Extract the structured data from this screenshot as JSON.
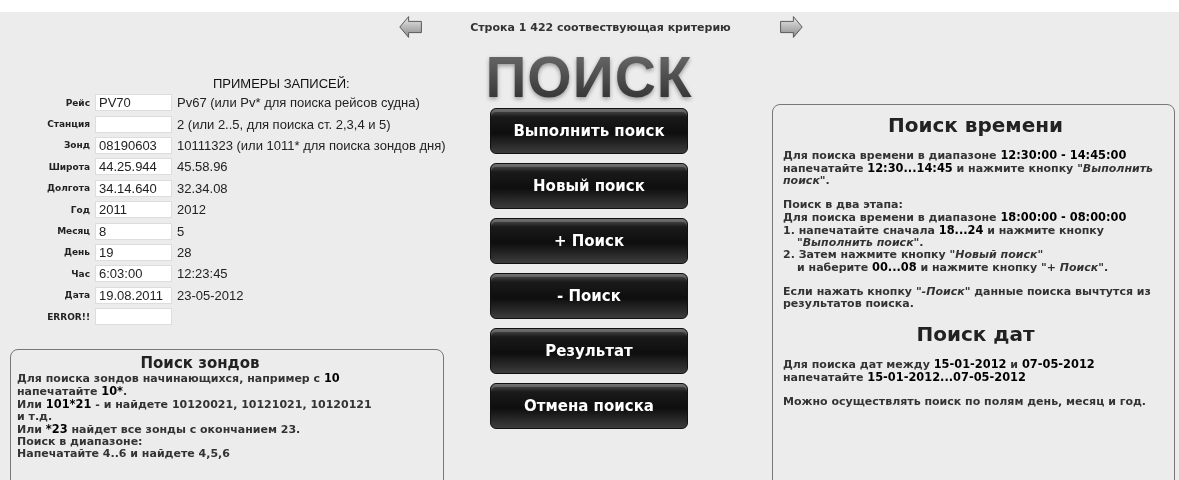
{
  "navigator": {
    "status": "Строка 1  422 соотвествующая критерию"
  },
  "examples": {
    "heading": "ПРИМЕРЫ ЗАПИСЕЙ:",
    "fields": [
      {
        "label": "Рейс",
        "value": "PV70",
        "example": "Pv67 (или Pv* для поиска рейсов судна)"
      },
      {
        "label": "Станция",
        "example": "2 (или 2..5, для поиска ст. 2,3,4 и 5)"
      },
      {
        "label": "Зонд",
        "value": "08190603",
        "example": "10111323 (или 1011* для поиска зондов дня)"
      },
      {
        "label": "Широта",
        "value": "44.25.944",
        "example": "45.58.96"
      },
      {
        "label": "Долгота",
        "value": "34.14.640",
        "example": "32.34.08"
      },
      {
        "label": "Год",
        "value": "2011",
        "example": "2012"
      },
      {
        "label": "Месяц",
        "value": "8",
        "example": "5"
      },
      {
        "label": "День",
        "value": "19",
        "example": "28"
      },
      {
        "label": "Час",
        "value": "6:03:00",
        "example": "12:23:45"
      },
      {
        "label": "Дата",
        "value": "19.08.2011",
        "example": "23-05-2012"
      },
      {
        "label": "ERROR!!"
      }
    ]
  },
  "title": "ПОИСК",
  "buttons": [
    "Выполнить поиск",
    "Новый поиск",
    "+ Поиск",
    "- Поиск",
    "Результат",
    "Отмена поиска"
  ],
  "probe_help": {
    "title": "Поиск зондов",
    "lines": [
      {
        "indented": false,
        "parts": [
          {
            "kind": "plain",
            "text": "Для поиска зондов начинающихся, например с "
          },
          {
            "kind": "strong",
            "text": "10"
          },
          {
            "kind": "plain",
            "text": " напечатайте "
          },
          {
            "kind": "strong",
            "text": "10*"
          },
          {
            "kind": "plain",
            "text": "."
          }
        ]
      },
      {
        "indented": false,
        "parts": [
          {
            "kind": "plain",
            "text": "Или  "
          },
          {
            "kind": "strong",
            "text": "101*21"
          },
          {
            "kind": "plain",
            "text": " - и найдете  10120021, 10121021, 10120121 и т.д."
          }
        ]
      },
      {
        "indented": false,
        "parts": [
          {
            "kind": "plain",
            "text": "Или  "
          },
          {
            "kind": "strong",
            "text": "*23"
          },
          {
            "kind": "plain",
            "text": " найдет все зонды с окончанием  23."
          }
        ]
      },
      {
        "indented": false,
        "parts": [
          {
            "kind": "plain",
            "text": "Поиск в диапазоне:"
          }
        ]
      },
      {
        "indented": false,
        "parts": [
          {
            "kind": "plain",
            "text": "Напечатайте 4..6 и найдете 4,5,6"
          }
        ]
      }
    ]
  },
  "time_help": {
    "blocks": [
      {
        "kind": "heading",
        "text": "Поиск времени"
      },
      {
        "kind": "paragraph",
        "lines": [
          {
            "indented": false,
            "parts": [
              {
                "kind": "plain",
                "text": "Для поиска времени в диапазоне "
              },
              {
                "kind": "strong",
                "text": "12:30:00 - 14:45:00"
              },
              {
                "kind": "plain",
                "text": " напечатайте "
              },
              {
                "kind": "strong",
                "text": "12:30...14:45"
              },
              {
                "kind": "plain",
                "text": " и нажмите кнопку "
              },
              {
                "kind": "em",
                "text": "\"Выполнить поиск\""
              },
              {
                "kind": "plain",
                "text": "."
              }
            ]
          }
        ]
      },
      {
        "kind": "paragraph",
        "lines": [
          {
            "indented": false,
            "parts": [
              {
                "kind": "plain",
                "text": "Поиск в два этапа:"
              }
            ]
          },
          {
            "indented": false,
            "parts": [
              {
                "kind": "plain",
                "text": "Для поиска времени в диапазоне "
              },
              {
                "kind": "strong",
                "text": "18:00:00 - 08:00:00"
              }
            ]
          },
          {
            "indented": false,
            "parts": [
              {
                "kind": "plain",
                "text": "1. напечатайте  сначала "
              },
              {
                "kind": "strong",
                "text": "18...24"
              },
              {
                "kind": "plain",
                "text": " и нажмите кнопку"
              }
            ]
          },
          {
            "indented": true,
            "parts": [
              {
                "kind": "em",
                "text": "\"Выполнить поиск\""
              },
              {
                "kind": "plain",
                "text": "."
              }
            ]
          },
          {
            "indented": false,
            "parts": [
              {
                "kind": "plain",
                "text": "2. Затем нажмите кнопку "
              },
              {
                "kind": "em",
                "text": "\"Новый поиск\""
              }
            ]
          },
          {
            "indented": true,
            "parts": [
              {
                "kind": "plain",
                "text": "и наберите "
              },
              {
                "kind": "strong",
                "text": "00...08"
              },
              {
                "kind": "plain",
                "text": " и нажмите кнопку \"+ "
              },
              {
                "kind": "em",
                "text": "Поиск\""
              },
              {
                "kind": "plain",
                "text": "."
              }
            ]
          }
        ]
      },
      {
        "kind": "paragraph",
        "lines": [
          {
            "indented": false,
            "parts": [
              {
                "kind": "plain",
                "text": "Если нажать кнопку "
              },
              {
                "kind": "em",
                "text": "\"-Поиск\""
              },
              {
                "kind": "plain",
                "text": " данные поиска вычтутся из результатов поиска."
              }
            ]
          }
        ]
      },
      {
        "kind": "heading",
        "text": "Поиск дат"
      },
      {
        "kind": "paragraph",
        "lines": [
          {
            "indented": false,
            "parts": [
              {
                "kind": "plain",
                "text": "Для поиска дат между "
              },
              {
                "kind": "strong",
                "text": "15-01-2012"
              },
              {
                "kind": "plain",
                "text": " и "
              },
              {
                "kind": "strong",
                "text": "07-05-2012"
              }
            ]
          },
          {
            "indented": false,
            "parts": [
              {
                "kind": "plain",
                "text": "напечатайте "
              },
              {
                "kind": "strong",
                "text": "15-01-2012...07-05-2012"
              }
            ]
          }
        ]
      },
      {
        "kind": "paragraph",
        "lines": [
          {
            "indented": false,
            "parts": [
              {
                "kind": "plain",
                "text": "Можно осуществлять поиск по полям день, месяц и год."
              }
            ]
          }
        ]
      }
    ]
  }
}
